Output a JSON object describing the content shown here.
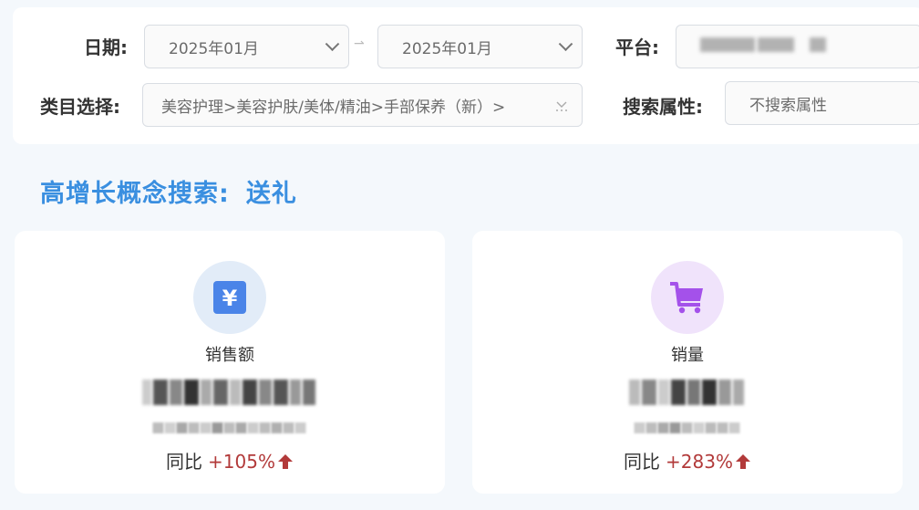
{
  "filters": {
    "date_label": "日期:",
    "date_start": "2025年01月",
    "date_end": "2025年01月",
    "platform_label": "平台:",
    "category_label": "类目选择:",
    "category_value": "美容护理>美容护肤/美体/精油>手部保养（新）>",
    "search_attr_label": "搜索属性:",
    "search_attr_value": "不搜索属性"
  },
  "section": {
    "title": "高增长概念搜索:",
    "keyword": "送礼"
  },
  "cards": [
    {
      "label": "销售额",
      "icon": "yuan-icon",
      "icon_symbol": "¥",
      "icon_bg": "#e2ecf8",
      "icon_color": "#4a84e8",
      "yoy_label": "同比",
      "yoy_value": "+105%"
    },
    {
      "label": "销量",
      "icon": "shopping-cart-icon",
      "icon_bg": "#f0e3fb",
      "icon_color": "#a451ea",
      "yoy_label": "同比",
      "yoy_value": "+283%"
    }
  ],
  "colors": {
    "accent": "#3a8fe0",
    "growth": "#b23a3a"
  }
}
